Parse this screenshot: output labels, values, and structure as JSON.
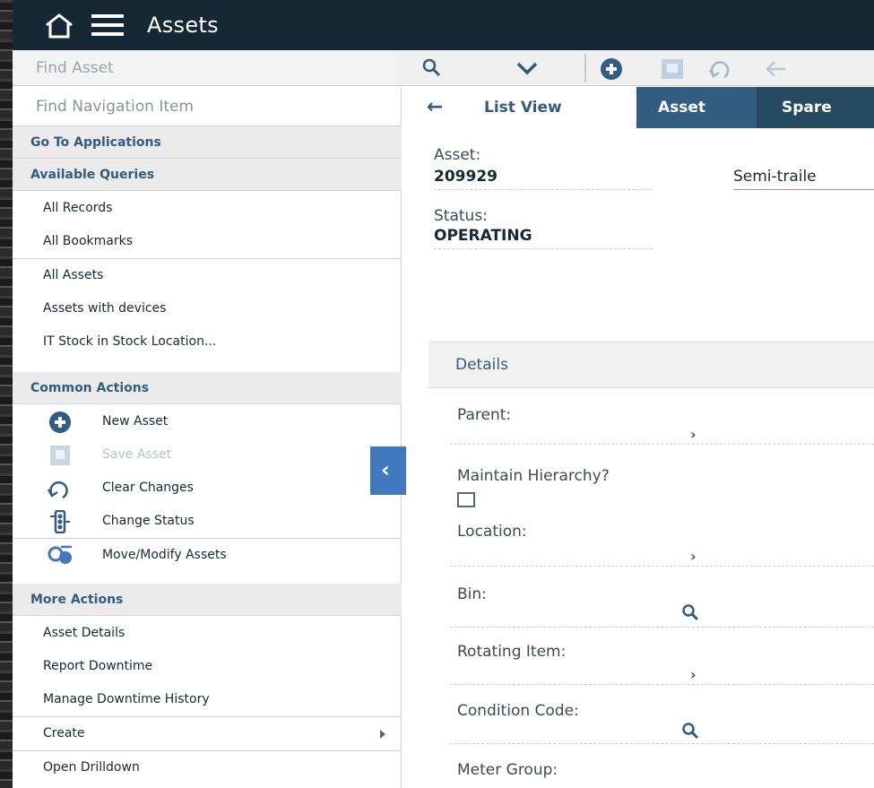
{
  "header": {
    "title": "Assets"
  },
  "find_asset": {
    "placeholder": "Find Asset"
  },
  "toolbar_icons": [
    "search-icon",
    "chevron-down-icon",
    "new-record-icon",
    "save-icon",
    "undo-icon",
    "back-arrow-icon"
  ],
  "nav": {
    "find_placeholder": "Find Navigation Item",
    "go_to_applications": "Go To Applications",
    "available_queries": "Available Queries",
    "queries": [
      "All Records",
      "All Bookmarks",
      "All Assets",
      "Assets with devices",
      "IT Stock in Stock Location..."
    ],
    "common_actions": "Common Actions",
    "actions": [
      {
        "label": "New Asset",
        "icon": "plus-circle-icon",
        "enabled": true
      },
      {
        "label": "Save Asset",
        "icon": "save-icon",
        "enabled": false
      },
      {
        "label": "Clear Changes",
        "icon": "undo-icon",
        "enabled": true
      },
      {
        "label": "Change Status",
        "icon": "status-icon",
        "enabled": true
      },
      {
        "label": "Move/Modify Assets",
        "icon": "move-modify-icon",
        "enabled": true
      }
    ],
    "more_actions": "More Actions",
    "more": [
      "Asset Details",
      "Report Downtime",
      "Manage Downtime History",
      "Create",
      "Open Drilldown"
    ]
  },
  "tabs": {
    "list_view": "List View",
    "asset": "Asset",
    "spare": "Spare"
  },
  "asset": {
    "asset_label": "Asset:",
    "asset_number": "209929",
    "description": "Semi-traile",
    "status_label": "Status:",
    "status_value": "OPERATING"
  },
  "details": {
    "section_title": "Details",
    "parent_label": "Parent:",
    "maintain_hierarchy_label": "Maintain Hierarchy?",
    "location_label": "Location:",
    "bin_label": "Bin:",
    "rotating_item_label": "Rotating Item:",
    "condition_code_label": "Condition Code:",
    "meter_group_label": "Meter Group:"
  },
  "colors": {
    "header": "#152935",
    "accent": "#4178be",
    "tab_active": "#325c80",
    "link": "#325c80"
  }
}
